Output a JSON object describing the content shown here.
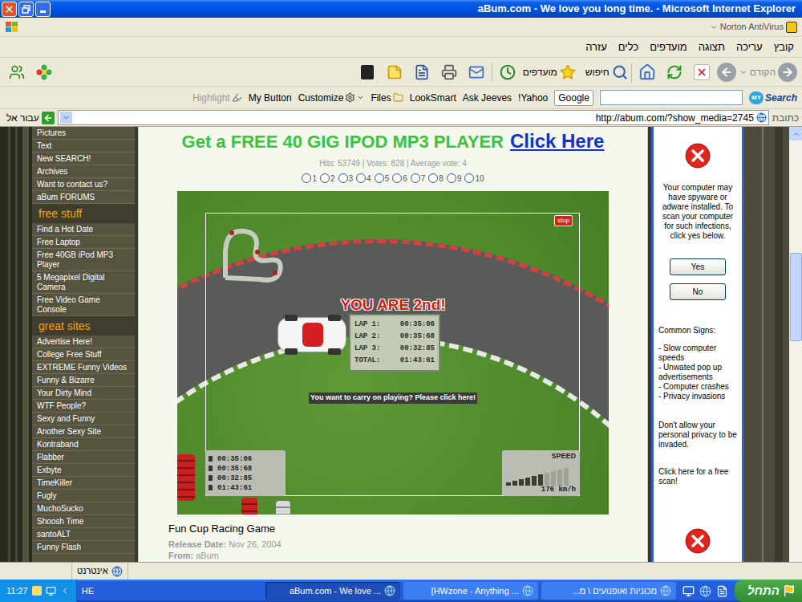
{
  "window": {
    "title": "aBum.com - We love you long time. - Microsoft Internet Explorer"
  },
  "norton": "Norton AntiVirus",
  "menu": [
    "קובץ",
    "עריכה",
    "תצוגה",
    "מועדפים",
    "כלים",
    "עזרה"
  ],
  "toolbar": {
    "back": "הקודם",
    "search": "חיפוש",
    "favorites": "מועדפים"
  },
  "google_bar": {
    "items": [
      "Highlight",
      "My Button",
      "Customize",
      "Files",
      "LookSmart",
      "Ask Jeeves",
      "!Yahoo"
    ],
    "google": "Google",
    "query": "",
    "brand_badge": "MY",
    "brand": "Search"
  },
  "address": {
    "label": "כתובת",
    "url": "http://abum.com/?show_media=2745",
    "go": "עבור אל"
  },
  "sidebar": {
    "top_items": [
      "Pictures",
      "Text",
      "New SEARCH!",
      "Archives",
      "Want to contact us?",
      "aBum FORUMS"
    ],
    "sections": [
      {
        "heading": "free stuff",
        "items": [
          "Find a Hot Date",
          "Free Laptop",
          "Free 40GB iPod MP3 Player",
          "5 Megapixel Digital Camera",
          "Free Video Game Console"
        ]
      },
      {
        "heading": "great sites",
        "items": [
          "Advertise Here!",
          "College Free Stuff",
          "EXTREME Funny Videos",
          "Funny & Bizarre",
          "Your Dirty Mind",
          "WTF People?",
          "Sexy and Funny",
          "Another Sexy Site",
          "Kontraband",
          "Flabber",
          "Exbyte",
          "TimeKiller",
          "Fugly",
          "MuchoSucko",
          "Shoosh Time",
          "santoALT",
          "Funny Flash"
        ]
      }
    ]
  },
  "banner": {
    "text": "Get a FREE 40 GIG IPOD MP3 PLAYER",
    "link": "Click Here"
  },
  "stats": "Hits: 53749 | Votes: 828 | Average vote: 4",
  "rating": [
    {
      "label": "1",
      "selected": false
    },
    {
      "label": "2",
      "selected": false
    },
    {
      "label": "3",
      "selected": false
    },
    {
      "label": "4",
      "selected": false
    },
    {
      "label": "5",
      "selected": false
    },
    {
      "label": "6",
      "selected": false
    },
    {
      "label": "7",
      "selected": false
    },
    {
      "label": "8",
      "selected": false
    },
    {
      "label": "9",
      "selected": false
    },
    {
      "label": "10",
      "selected": false
    }
  ],
  "game": {
    "stop": "stop",
    "result": "YOU ARE 2nd!",
    "laps": [
      {
        "label": "LAP 1:",
        "time": "00:35:06"
      },
      {
        "label": "LAP 2:",
        "time": "00:35:68"
      },
      {
        "label": "LAP 3:",
        "time": "00:32:85"
      },
      {
        "label": "TOTAL:",
        "time": "01:43:61"
      }
    ],
    "prompt": "You want to carry on playing? Please click here!",
    "hud_times": [
      "00:35:06",
      "00:35:68",
      "00:32:85",
      "01:43:61"
    ],
    "speed_label": "SPEED",
    "speed": "176 km/h",
    "speed_level": 0.6
  },
  "media": {
    "title": "Fun Cup Racing Game",
    "release_label": "Release Date:",
    "release": "Nov 26, 2004",
    "from_label": "From:",
    "from": "aBum"
  },
  "ad": {
    "warning": "Your computer may have spyware or adware installed. To scan your computer for such infections, click yes below.",
    "buttons": [
      "Yes",
      "No"
    ],
    "signs_title": "Common Signs:",
    "signs": [
      "- Slow computer speeds",
      "- Unwated pop up advertisements",
      "- Computer crashes",
      "- Privacy invasions"
    ],
    "privacy": "Don't allow your personal privacy to be invaded.",
    "scan": "Click here for a free scan!"
  },
  "status_bar": {
    "zone": "אינטרנט"
  },
  "taskbar": {
    "start": "התחל",
    "clock": "11:27",
    "lang": "HE",
    "tasks": [
      {
        "label": "... aBum.com - We love",
        "selected": true
      },
      {
        "label": "... HWzone - Anything]",
        "selected": false
      },
      {
        "label": "מכוניות ואופנועים \\ מ...",
        "selected": false
      }
    ]
  }
}
